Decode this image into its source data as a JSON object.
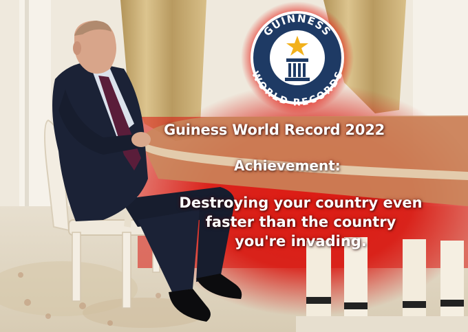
{
  "logo": {
    "top_text": "GUINNESS",
    "bottom_text": "WORLD RECORDS"
  },
  "caption": {
    "title": "Guiness World Record 2022",
    "subtitle": "Achievement:",
    "body_lines": [
      "Destroying your country even",
      "faster than the country",
      "you're invading."
    ]
  },
  "colors": {
    "overlay_red": "#e01a12",
    "logo_navy": "#1e3a64",
    "logo_star": "#f2b11b",
    "suit": "#1b2236",
    "tie": "#5a1d3a",
    "chair": "#f3ede2",
    "table": "#c9a27a",
    "curtain": "#cdb27a"
  }
}
